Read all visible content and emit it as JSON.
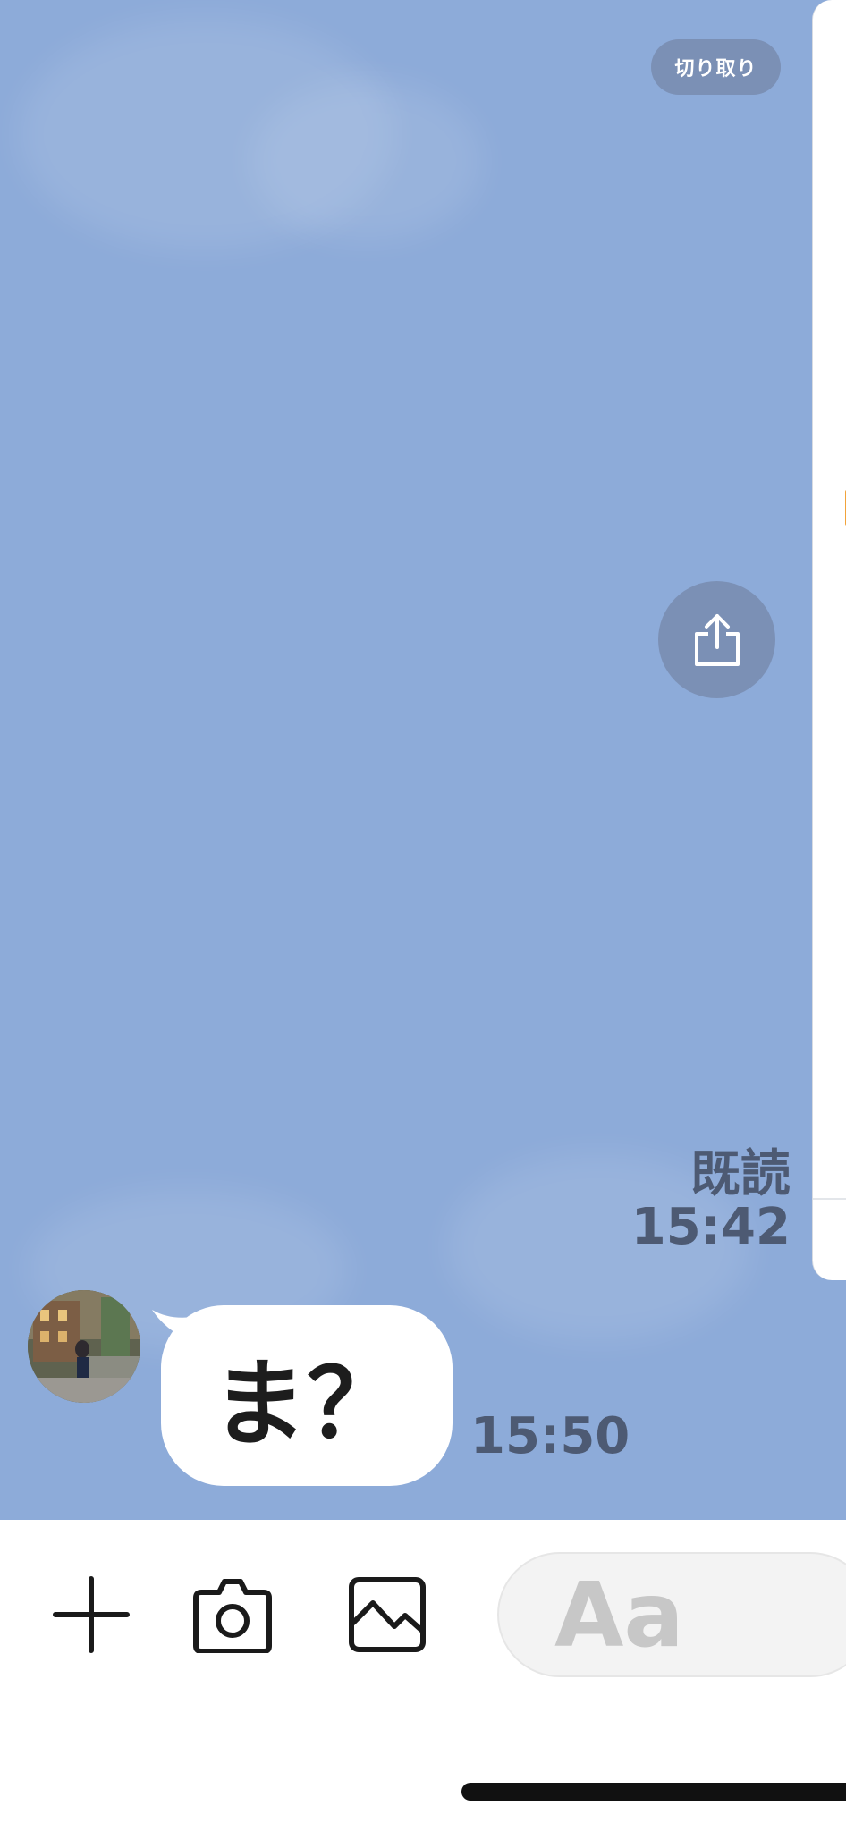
{
  "toolbar": {
    "crop_label": "切り取り"
  },
  "messages": {
    "sent": {
      "read_label": "既読",
      "time": "15:42"
    },
    "received": {
      "text": "ま？",
      "time": "15:50"
    }
  },
  "input": {
    "placeholder": "Aa"
  },
  "colors": {
    "chat_background": "#8dabd9",
    "bubble": "#ffffff",
    "meta_text": "#4d5a73",
    "overlay_button": "#7687a8"
  },
  "icons": {
    "share": "share-icon",
    "plus": "plus-icon",
    "camera": "camera-icon",
    "image": "image-icon"
  }
}
